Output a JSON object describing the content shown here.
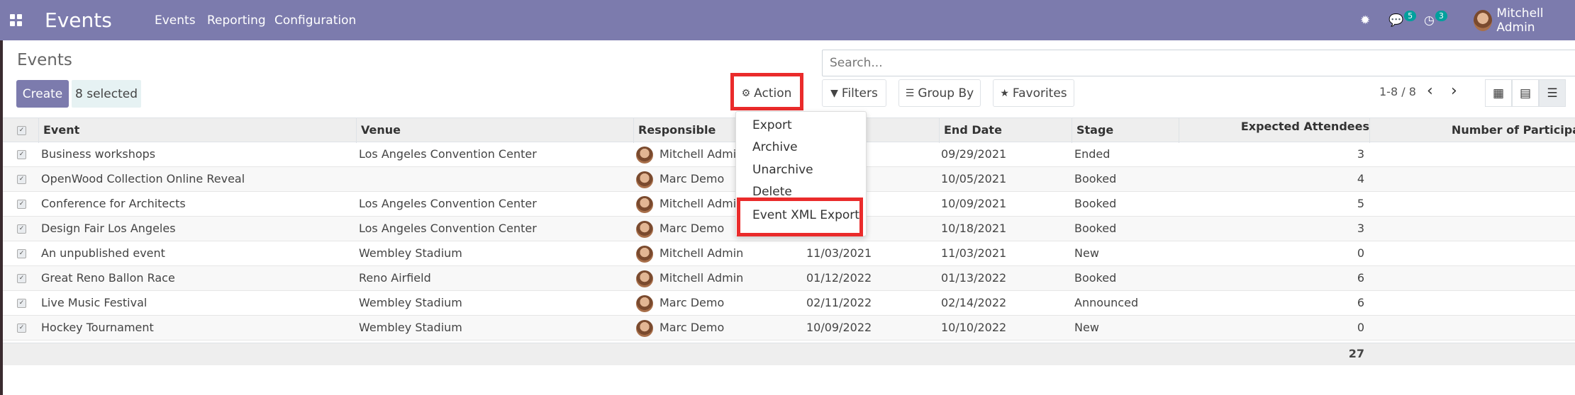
{
  "navbar": {
    "brand": "Events",
    "menu": [
      "Events",
      "Reporting",
      "Configuration"
    ],
    "messages_count": "5",
    "activities_count": "3",
    "user": "Mitchell Admin"
  },
  "control_panel": {
    "title": "Events",
    "create_label": "Create",
    "selected_label": "8 selected",
    "action_label": "Action",
    "filters_label": "Filters",
    "group_by_label": "Group By",
    "favorites_label": "Favorites",
    "search_placeholder": "Search...",
    "pager": "1-8 / 8"
  },
  "action_menu": {
    "items": [
      "Export",
      "Archive",
      "Unarchive",
      "Delete",
      "Event XML Export"
    ]
  },
  "table": {
    "headers": {
      "event": "Event",
      "venue": "Venue",
      "responsible": "Responsible",
      "end_date": "End Date",
      "stage": "Stage",
      "expected": "Expected Attendees",
      "participants": "Number of Participa"
    },
    "rows": [
      {
        "event": "Business workshops",
        "venue": "Los Angeles Convention Center",
        "responsible": "Mitchell Admin",
        "start": "",
        "end": "09/29/2021",
        "stage": "Ended",
        "expected": "3"
      },
      {
        "event": "OpenWood Collection Online Reveal",
        "venue": "",
        "responsible": "Marc Demo",
        "start": "",
        "end": "10/05/2021",
        "stage": "Booked",
        "expected": "4"
      },
      {
        "event": "Conference for Architects",
        "venue": "Los Angeles Convention Center",
        "responsible": "Mitchell Admin",
        "start": "",
        "end": "10/09/2021",
        "stage": "Booked",
        "expected": "5"
      },
      {
        "event": "Design Fair Los Angeles",
        "venue": "Los Angeles Convention Center",
        "responsible": "Marc Demo",
        "start": "",
        "end": "10/18/2021",
        "stage": "Booked",
        "expected": "3"
      },
      {
        "event": "An unpublished event",
        "venue": "Wembley Stadium",
        "responsible": "Mitchell Admin",
        "start": "11/03/2021",
        "end": "11/03/2021",
        "stage": "New",
        "expected": "0"
      },
      {
        "event": "Great Reno Ballon Race",
        "venue": "Reno Airfield",
        "responsible": "Mitchell Admin",
        "start": "01/12/2022",
        "end": "01/13/2022",
        "stage": "Booked",
        "expected": "6"
      },
      {
        "event": "Live Music Festival",
        "venue": "Wembley Stadium",
        "responsible": "Marc Demo",
        "start": "02/11/2022",
        "end": "02/14/2022",
        "stage": "Announced",
        "expected": "6"
      },
      {
        "event": "Hockey Tournament",
        "venue": "Wembley Stadium",
        "responsible": "Marc Demo",
        "start": "10/09/2022",
        "end": "10/10/2022",
        "stage": "New",
        "expected": "0"
      }
    ],
    "total_expected": "27"
  }
}
